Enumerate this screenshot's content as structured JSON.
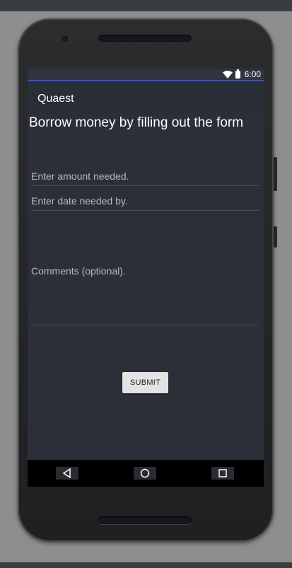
{
  "status_bar": {
    "time": "6:00",
    "wifi_icon": "wifi-icon",
    "battery_icon": "battery-icon"
  },
  "app_bar": {
    "title": "Quaest"
  },
  "form": {
    "heading": "Borrow money by filling out the form",
    "amount_placeholder": "Enter amount needed.",
    "date_placeholder": "Enter date needed by.",
    "comments_placeholder": "Comments (optional).",
    "submit_label": "SUBMIT"
  },
  "nav_bar": {
    "back_icon": "back-triangle-icon",
    "home_icon": "home-circle-icon",
    "recents_icon": "recents-square-icon"
  },
  "colors": {
    "accent": "#3f51b5",
    "screen_bg": "#2b2f38",
    "button_bg": "#e3e3e3"
  }
}
